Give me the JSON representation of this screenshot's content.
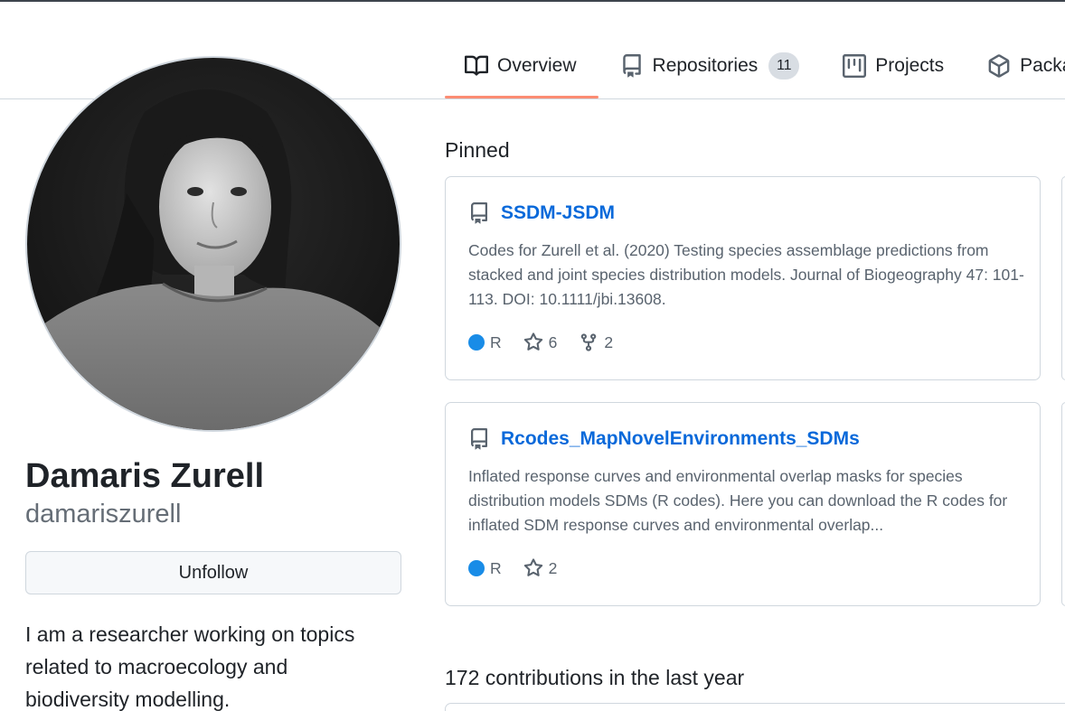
{
  "tabs": [
    {
      "label": "Overview",
      "icon": "book-icon"
    },
    {
      "label": "Repositories",
      "icon": "repo-icon",
      "count": "11"
    },
    {
      "label": "Projects",
      "icon": "project-icon"
    },
    {
      "label": "Packa",
      "icon": "package-icon"
    }
  ],
  "profile": {
    "name": "Damaris Zurell",
    "login": "damariszurell",
    "follow_button": "Unfollow",
    "bio": "I am a researcher working on topics related to macroecology and biodiversity modelling."
  },
  "pinned": {
    "title": "Pinned",
    "cards": [
      {
        "name": "SSDM-JSDM",
        "description": "Codes for Zurell et al. (2020) Testing species assemblage predictions from stacked and joint species distribution models. Journal of Biogeography 47: 101-113. DOI: 10.1111/jbi.13608.",
        "language": "R",
        "language_color": "#198ce7",
        "stars": "6",
        "forks": "2"
      },
      {
        "name": "Rcodes_MapNovelEnvironments_SDMs",
        "description": "Inflated response curves and environmental overlap masks for species distribution models SDMs (R codes). Here you can download the R codes for inflated SDM response curves and environmental overlap...",
        "language": "R",
        "language_color": "#198ce7",
        "stars": "2"
      }
    ]
  },
  "contributions": {
    "title": "172 contributions in the last year"
  },
  "colors": {
    "link": "#0969da",
    "active_tab_underline": "#fd8c73",
    "muted_text": "#59636e"
  }
}
